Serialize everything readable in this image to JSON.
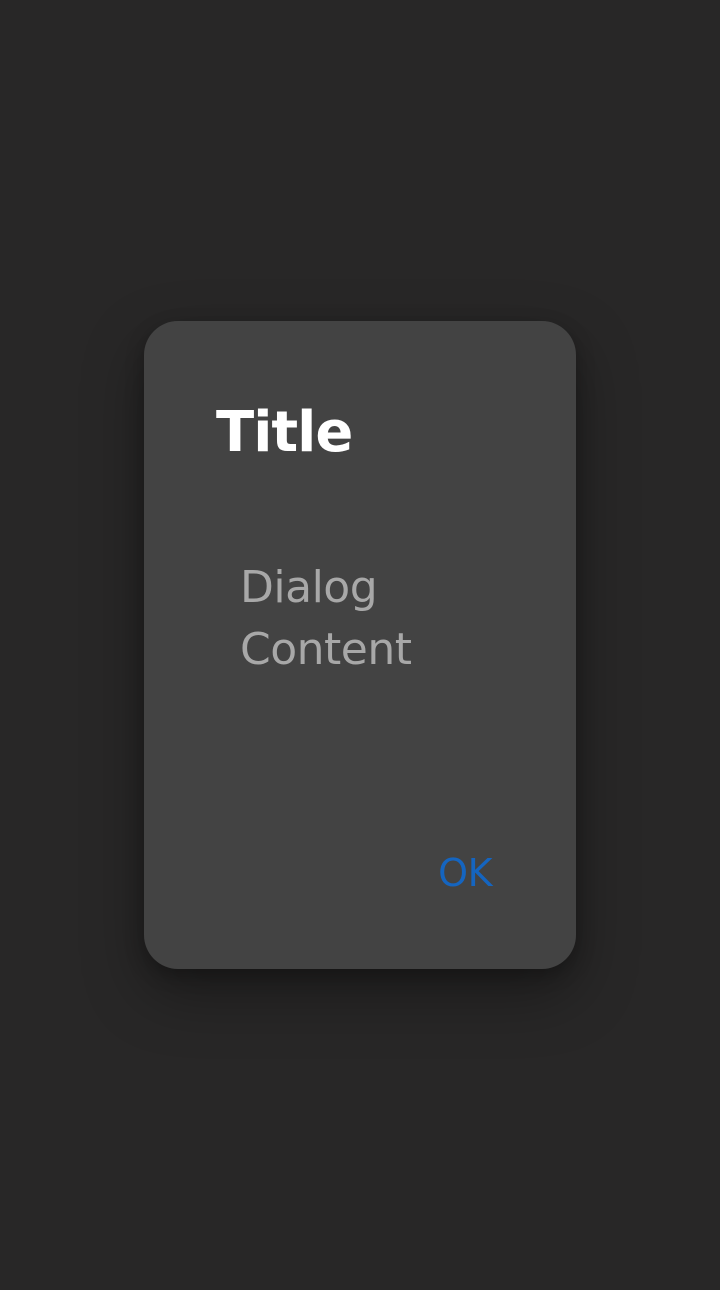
{
  "dialog": {
    "title": "Title",
    "content": "Dialog Content",
    "ok_label": "OK"
  },
  "colors": {
    "background": "#282727",
    "surface": "#434343",
    "title": "#ffffff",
    "content": "#a8a8a8",
    "accent": "#1565c0"
  }
}
